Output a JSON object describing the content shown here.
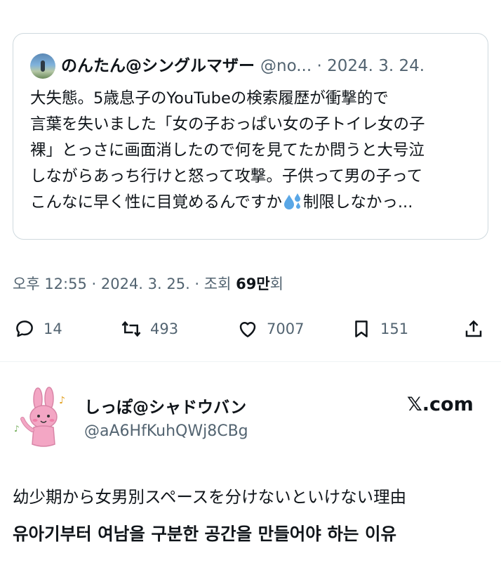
{
  "quoted_tweet": {
    "author_name": "のんたん@シングルマザー",
    "handle_date": "@no... · 2024. 3. 24.",
    "lines": [
      "大失態。5歳息子のYouTubeの検索履歴が衝撃的で",
      "言葉を失いました「女の子おっぱい女の子トイレ女の子",
      "裸」とっさに画面消したので何を見てたか問うと大号泣",
      "しながらあっち行けと怒って攻撃。子供って男の子って",
      "こんなに早く性に目覚めるんですか",
      "制限しなかっ..."
    ],
    "emoji_icon": "sweat-droplets-icon"
  },
  "tweet_meta": {
    "time_date": "오후 12:55 · 2024. 3. 25. · 조회 ",
    "views": "69만",
    "views_suffix": "회"
  },
  "actions": {
    "replies": "14",
    "retweets": "493",
    "likes": "7007",
    "bookmarks": "151"
  },
  "author": {
    "name": "しっぽ@シャドウバン",
    "handle": "@aA6HfKuhQWj8CBg",
    "avatar_icon": "pink-rabbit-icon"
  },
  "source": "𝕏.com",
  "caption_jp": "幼少期から女男別スペースを分けないといけない理由",
  "caption_kr": "유아기부터 여남을 구분한 공간을 만들어야 하는 이유",
  "colors": {
    "text": "#0f1419",
    "secondary": "#536471",
    "border": "#cfd9de",
    "rabbit_pink": "#f3a6c4"
  }
}
